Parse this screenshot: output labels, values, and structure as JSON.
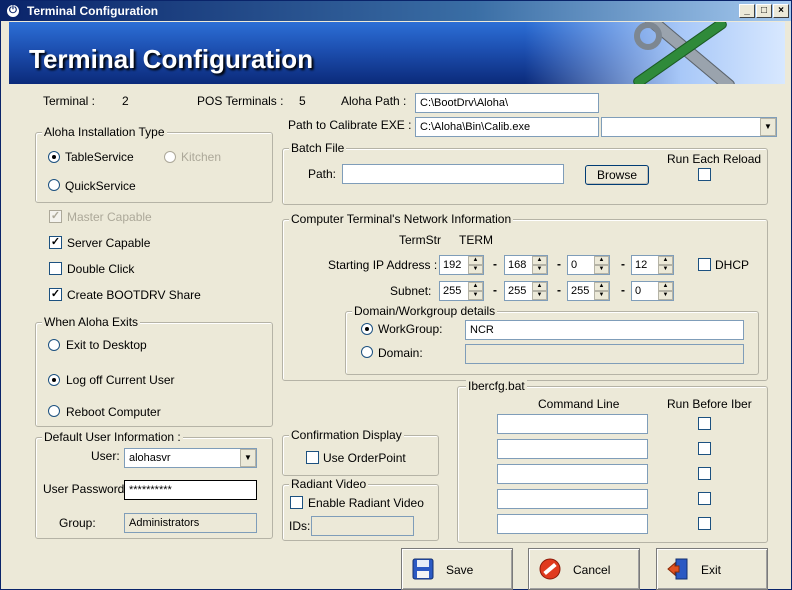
{
  "window": {
    "title": "Terminal Configuration",
    "banner_title": "Terminal Configuration"
  },
  "top": {
    "terminal_label": "Terminal :",
    "terminal_value": "2",
    "pos_terminals_label": "POS Terminals :",
    "pos_terminals_value": "5",
    "aloha_path_label": "Aloha Path :",
    "aloha_path_value": "C:\\BootDrv\\Aloha\\",
    "calibrate_label": "Path to Calibrate EXE :",
    "calibrate_value": "C:\\Aloha\\Bin\\Calib.exe",
    "calibrate_combo_value": ""
  },
  "install_type": {
    "title": "Aloha Installation Type",
    "table_service": "TableService",
    "kitchen": "Kitchen",
    "quick_service": "QuickService"
  },
  "options": {
    "master_capable": "Master Capable",
    "server_capable": "Server Capable",
    "double_click": "Double Click",
    "create_bootdrv": "Create BOOTDRV Share"
  },
  "exit_group": {
    "title": "When Aloha Exits",
    "exit_desktop": "Exit to Desktop",
    "log_off": "Log off Current User",
    "reboot": "Reboot Computer"
  },
  "user_info": {
    "title": "Default User Information :",
    "user_label": "User:",
    "user_value": "alohasvr",
    "password_label": "User Password:",
    "password_value": "**********",
    "group_label": "Group:",
    "group_value": "Administrators"
  },
  "batch": {
    "title": "Batch File",
    "path_label": "Path:",
    "path_value": "",
    "browse": "Browse",
    "run_each_reload": "Run Each Reload"
  },
  "network": {
    "title": "Computer Terminal's Network Information",
    "termstr_label": "TermStr",
    "termstr_value": "TERM",
    "ip_label": "Starting IP Address :",
    "ip": [
      "192",
      "168",
      "0",
      "12"
    ],
    "dhcp": "DHCP",
    "subnet_label": "Subnet:",
    "subnet": [
      "255",
      "255",
      "255",
      "0"
    ],
    "domain_title": "Domain/Workgroup details",
    "workgroup_label": "WorkGroup:",
    "workgroup_value": "NCR",
    "domain_label": "Domain:",
    "domain_value": ""
  },
  "confirmation": {
    "title": "Confirmation Display",
    "use_orderpoint": "Use OrderPoint"
  },
  "radiant": {
    "title": "Radiant Video",
    "enable": "Enable Radiant Video",
    "ids_label": "IDs:",
    "ids_value": ""
  },
  "ibercfg": {
    "title": "Ibercfg.bat",
    "col_command": "Command Line",
    "col_run_before": "Run Before Iber",
    "rows": [
      "",
      "",
      "",
      "",
      ""
    ]
  },
  "buttons": {
    "save": "Save",
    "cancel": "Cancel",
    "exit": "Exit"
  },
  "colors": {
    "titlebar": "#0a246a",
    "banner": "#1d4fb0",
    "face": "#ece9d8"
  }
}
